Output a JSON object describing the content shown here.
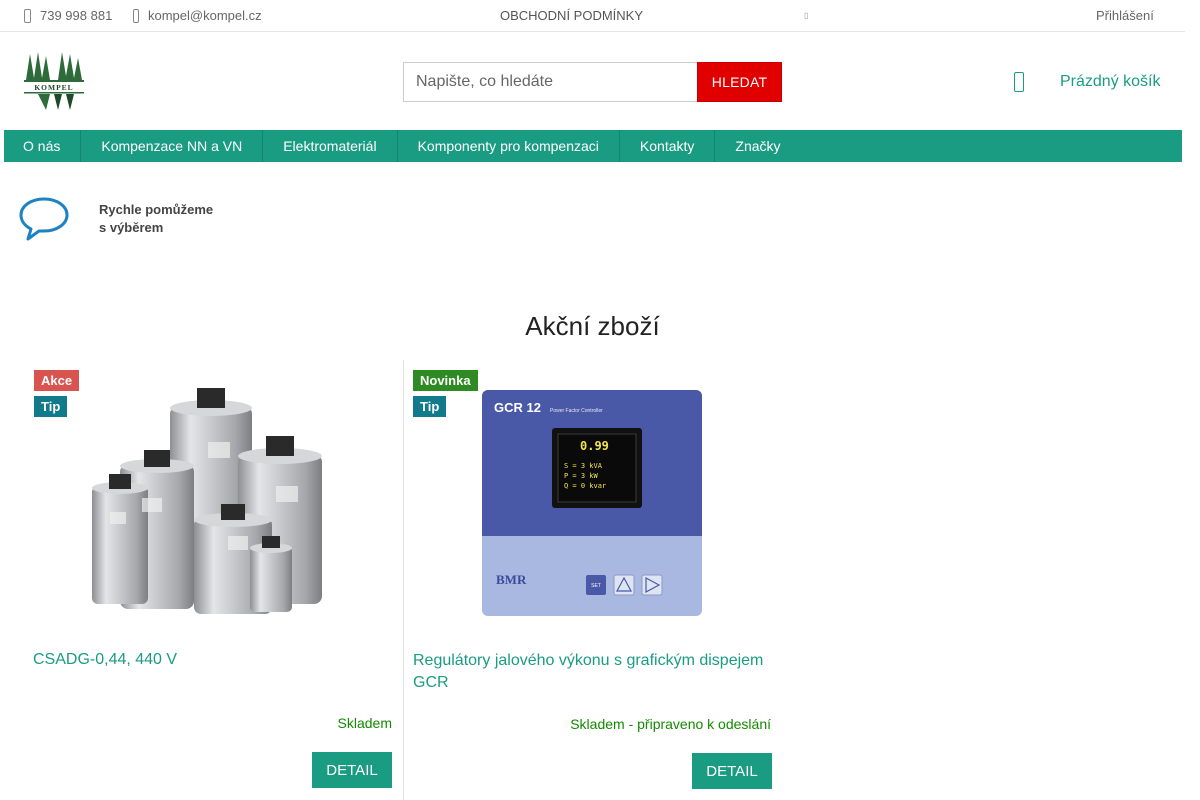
{
  "topbar": {
    "phone": "739 998 881",
    "email": "kompel@kompel.cz",
    "terms": "OBCHODNÍ PODMÍNKY",
    "login": "Přihlášení"
  },
  "header": {
    "logo_text": "KOMPEL",
    "search_placeholder": "Napište, co hledáte",
    "search_button": "HLEDAT",
    "cart_label": "Prázdný košík"
  },
  "nav": {
    "items": [
      {
        "label": "O nás"
      },
      {
        "label": "Kompenzace NN a VN"
      },
      {
        "label": "Elektromateriál"
      },
      {
        "label": "Komponenty pro kompenzaci"
      },
      {
        "label": "Kontakty"
      },
      {
        "label": "Značky"
      }
    ]
  },
  "help": {
    "line1": "Rychle pomůžeme",
    "line2": "s výběrem"
  },
  "section": {
    "title": "Akční zboží"
  },
  "products": [
    {
      "badges": [
        "Akce",
        "Tip"
      ],
      "name": "CSADG-0,44, 440 V",
      "stock": "Skladem",
      "detail": "DETAIL"
    },
    {
      "badges": [
        "Novinka",
        "Tip"
      ],
      "name": "Regulátory jalového výkonu s grafickým dispejem GCR",
      "stock": "Skladem - připraveno k odeslání",
      "detail": "DETAIL",
      "device": {
        "model": "GCR 12",
        "subtitle": "Power Factor Controller",
        "display_line1": "0.99",
        "display_line2": "S = 3 kVA",
        "display_line3": "P = 3 kW",
        "display_line4": "Q = 0 kvar",
        "brand": "BMR",
        "key_label": "SET"
      }
    }
  ],
  "colors": {
    "accent": "#1a9c83",
    "search_button": "#e00000",
    "badge_akce": "#d9534f",
    "badge_tip": "#117a8b",
    "badge_novinka": "#2e8b24",
    "stock": "#138a00"
  }
}
